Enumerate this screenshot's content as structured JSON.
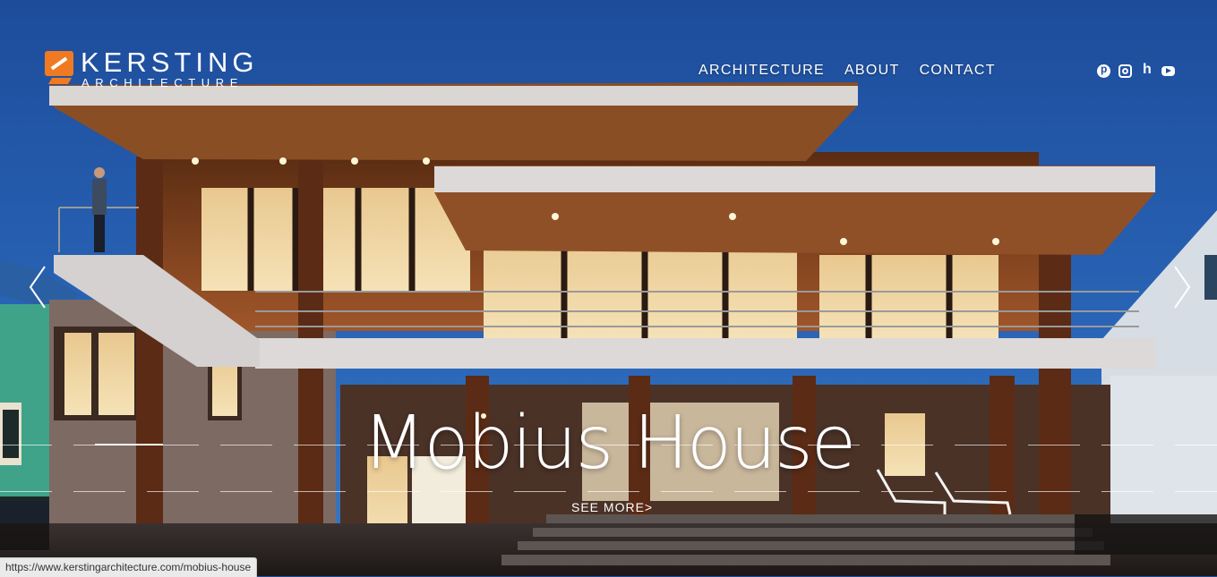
{
  "logo": {
    "name": "KERSTING",
    "tagline": "ARCHITECTURE"
  },
  "nav": {
    "architecture": "ARCHITECTURE",
    "about": "ABOUT",
    "contact": "CONTACT"
  },
  "social": {
    "icons": [
      "pinterest-icon",
      "instagram-icon",
      "houzz-icon",
      "youtube-icon"
    ]
  },
  "slide": {
    "title": "Mobius House",
    "cta": "SEE MORE>"
  },
  "status_bar": {
    "url": "https://www.kerstingarchitecture.com/mobius-house"
  },
  "colors": {
    "sky": "#1e4f9c",
    "accent": "#f07a22",
    "text": "#ffffff"
  }
}
